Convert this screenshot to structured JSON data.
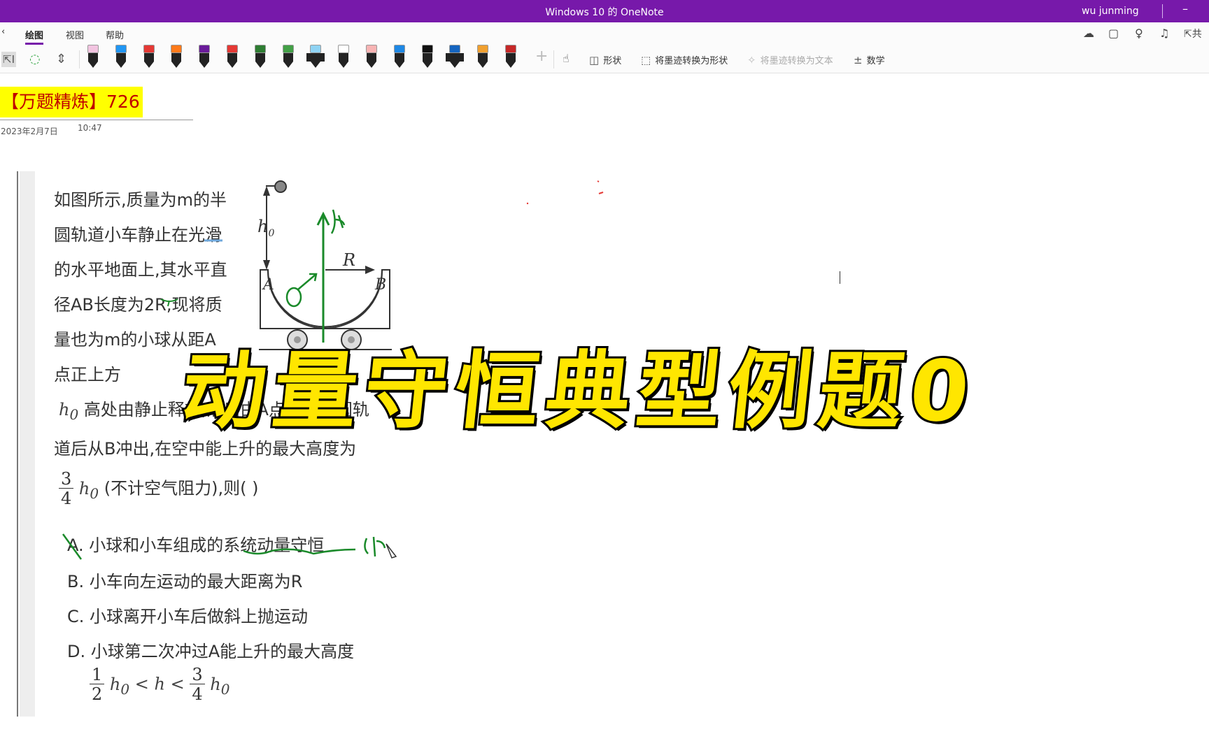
{
  "window": {
    "title": "Windows 10 的 OneNote",
    "user": "wu junming",
    "minimize": "–"
  },
  "ribbon": {
    "tabs": [
      {
        "label": "绘图",
        "active": true
      },
      {
        "label": "视图",
        "active": false
      },
      {
        "label": "帮助",
        "active": false
      }
    ],
    "right_icons": [
      "sync-icon",
      "notebook-icon",
      "lightbulb-icon",
      "bell-icon",
      "share-icon"
    ],
    "share_label": "共"
  },
  "toolbar": {
    "pens": [
      {
        "color": "#f2c4e0"
      },
      {
        "color": "#2196f3"
      },
      {
        "color": "#e53935"
      },
      {
        "color": "#ff7a1a"
      },
      {
        "color": "#6a1b9a"
      },
      {
        "color": "#e53935"
      },
      {
        "color": "#2e7d32"
      },
      {
        "color": "#43a047"
      },
      {
        "color": "#8fd3f4",
        "highlighter": true
      },
      {
        "color": "#ffffff"
      },
      {
        "color": "#f8b4b4"
      },
      {
        "color": "#1e88e5"
      },
      {
        "color": "#111111"
      },
      {
        "color": "#1565c0",
        "highlighter": true
      },
      {
        "color": "#f0a030"
      },
      {
        "color": "#c62828"
      }
    ],
    "shapes_label": "形状",
    "ink_to_shape_label": "将墨迹转换为形状",
    "ink_to_text_label": "将墨迹转换为文本",
    "math_label": "数学"
  },
  "page": {
    "title_prefix": "【万题精炼】",
    "title_number": "726",
    "date": "2023年2月7日",
    "time": "10:47"
  },
  "question": {
    "lines": [
      "如图所示,质量为m的半",
      "圆轨道小车静止在光滑",
      "的水平地面上,其水平直",
      "径AB长度为2R,现将质",
      "量也为m的小球从距A",
      "点正上方"
    ],
    "h0": "h",
    "h0_sub": "0",
    "line7_text": "高处由静止释放,然后由A点经过半圆轨",
    "line8": "道后从B冲出,在空中能上升的最大高度为",
    "frac_num": "3",
    "frac_den": "4",
    "line9_text": "(不计空气阻力),则(     )",
    "options": [
      {
        "letter": "A",
        "text": "小球和小车组成的系统动量守恒"
      },
      {
        "letter": "B",
        "text": "小车向左运动的最大距离为R"
      },
      {
        "letter": "C",
        "text": "小球离开小车后做斜上抛运动"
      },
      {
        "letter": "D",
        "text": "小球第二次冲过A能上升的最大高度"
      }
    ],
    "d_frac1_num": "1",
    "d_frac1_den": "2",
    "d_mid": "< h <",
    "d_frac2_num": "3",
    "d_frac2_den": "4"
  },
  "figure": {
    "label_h0": "h",
    "label_h0_sub": "0",
    "label_R": "R",
    "label_A": "A",
    "label_B": "B"
  },
  "overlay": {
    "text": "动量守恒典型例题0"
  }
}
